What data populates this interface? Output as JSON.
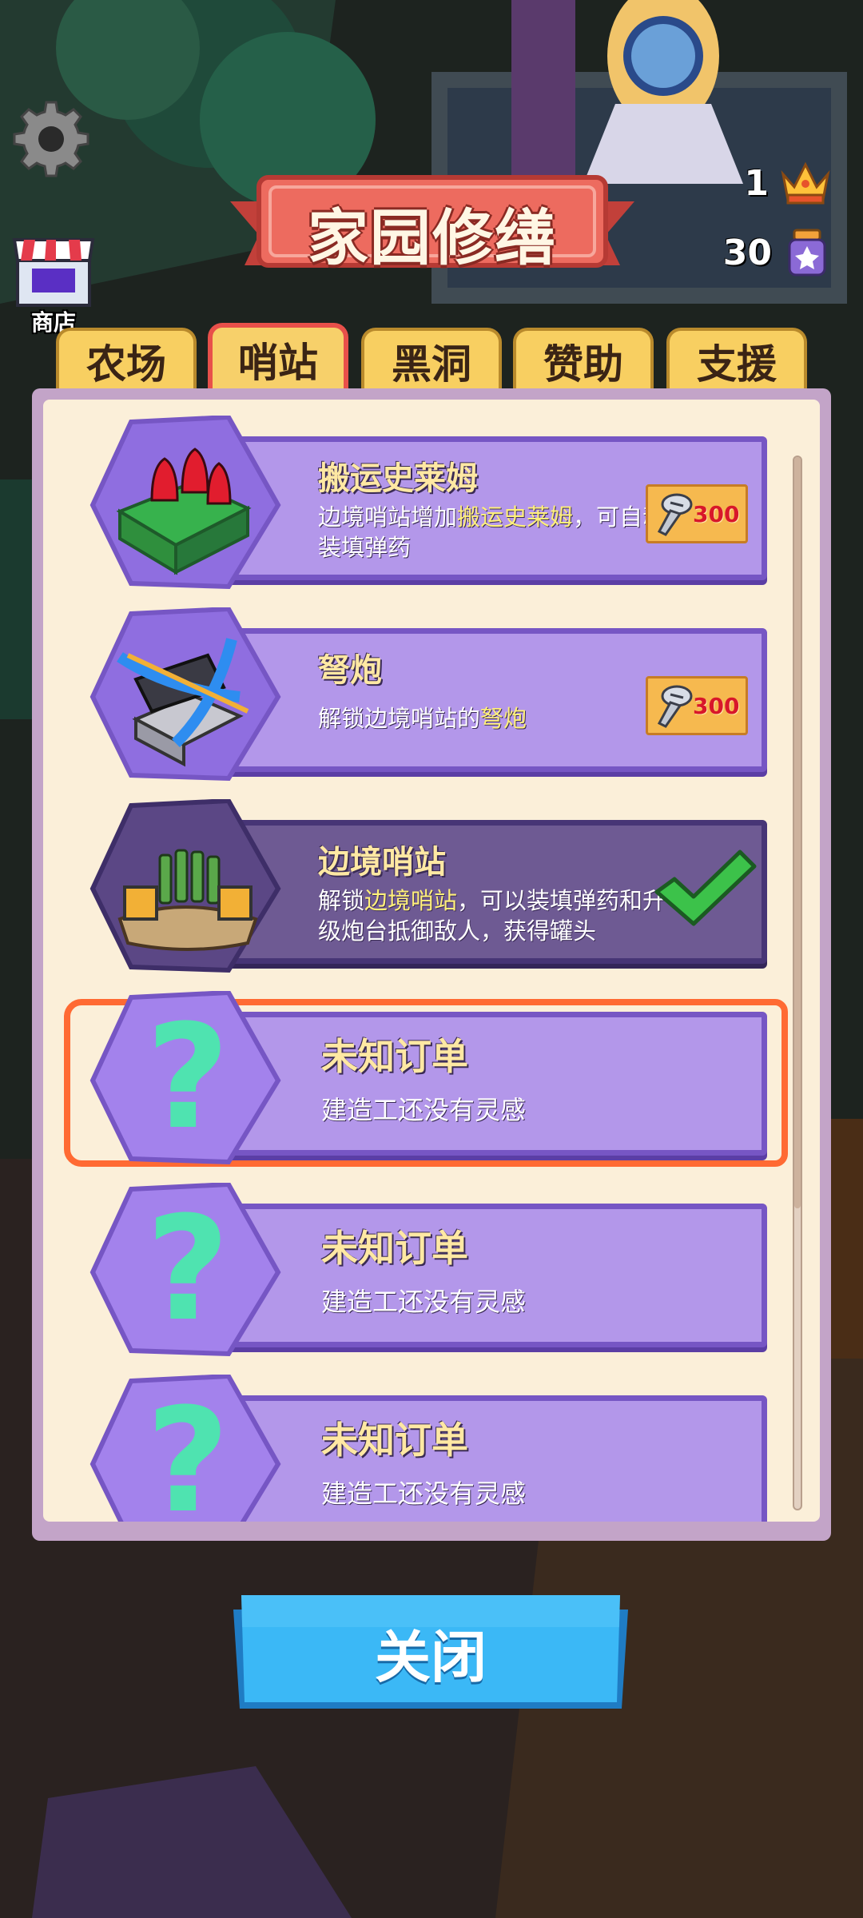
{
  "hud": {
    "shop_label": "商店",
    "crowns": "1",
    "gems": "30",
    "icons": [
      "gear-icon",
      "shop-icon",
      "crown-icon",
      "potion-icon"
    ]
  },
  "title": "家园修缮",
  "tabs": [
    {
      "label": "农场",
      "active": false
    },
    {
      "label": "哨站",
      "active": true
    },
    {
      "label": "黑洞",
      "active": false
    },
    {
      "label": "赞助",
      "active": false
    },
    {
      "label": "支援",
      "active": false
    }
  ],
  "items": [
    {
      "title": "搬运史莱姆",
      "desc_a": "边境哨站增加",
      "desc_hl": "搬运史莱姆",
      "desc_b": "，可自动装填弹药",
      "cost": "300",
      "status": "buy",
      "icon": "slime-crate-icon"
    },
    {
      "title": "弩炮",
      "desc_a": "解锁边境哨站的",
      "desc_hl": "弩炮",
      "desc_b": "",
      "cost": "300",
      "status": "buy",
      "icon": "ballista-icon"
    },
    {
      "title": "边境哨站",
      "desc_a": "解锁",
      "desc_hl": "边境哨站",
      "desc_b": "，可以装填弹药和升级炮台抵御敌人，获得罐头",
      "status": "done",
      "icon": "outpost-icon"
    },
    {
      "title": "未知订单",
      "desc": "建造工还没有灵感",
      "status": "unknown",
      "highlight": true
    },
    {
      "title": "未知订单",
      "desc": "建造工还没有灵感",
      "status": "unknown"
    },
    {
      "title": "未知订单",
      "desc": "建造工还没有灵感",
      "status": "unknown"
    }
  ],
  "close_label": "关闭",
  "colors": {
    "card": "#b397ea",
    "card_border": "#7656c4",
    "tab": "#f8cf61",
    "active_tab_border": "#e8504a",
    "close_button": "#3bb8f6",
    "highlight_border": "#ff6a33"
  }
}
